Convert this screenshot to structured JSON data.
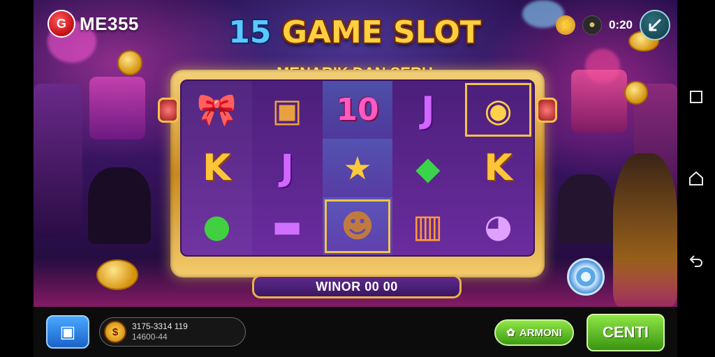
{
  "brand": {
    "logo_glyph": "G",
    "name": "ME355"
  },
  "status": {
    "timer": "0:20"
  },
  "title": {
    "number": "15",
    "main": "GAME SLOT",
    "subtitle": "MENARIK DAN SERU"
  },
  "reels": [
    [
      "bow-icon",
      "chest-icon",
      "10",
      "J",
      "coins-icon"
    ],
    [
      "K",
      "J",
      "star-icon",
      "gem-bag-icon",
      "K"
    ],
    [
      "bowl-icon",
      "purple-bowl-icon",
      "monster-icon",
      "lantern-icon",
      "bird-icon"
    ]
  ],
  "win_bar": {
    "label": "WINOR 00 00"
  },
  "bottom": {
    "balance_line1": "3175-3314 119",
    "balance_line2": "14600-44",
    "auto_label": "ARMONI",
    "spin_label": "CENTI"
  },
  "colors": {
    "frame_gold": "#e8b443",
    "spin_green": "#5cc21e",
    "reel_purple": "#5a2590"
  }
}
